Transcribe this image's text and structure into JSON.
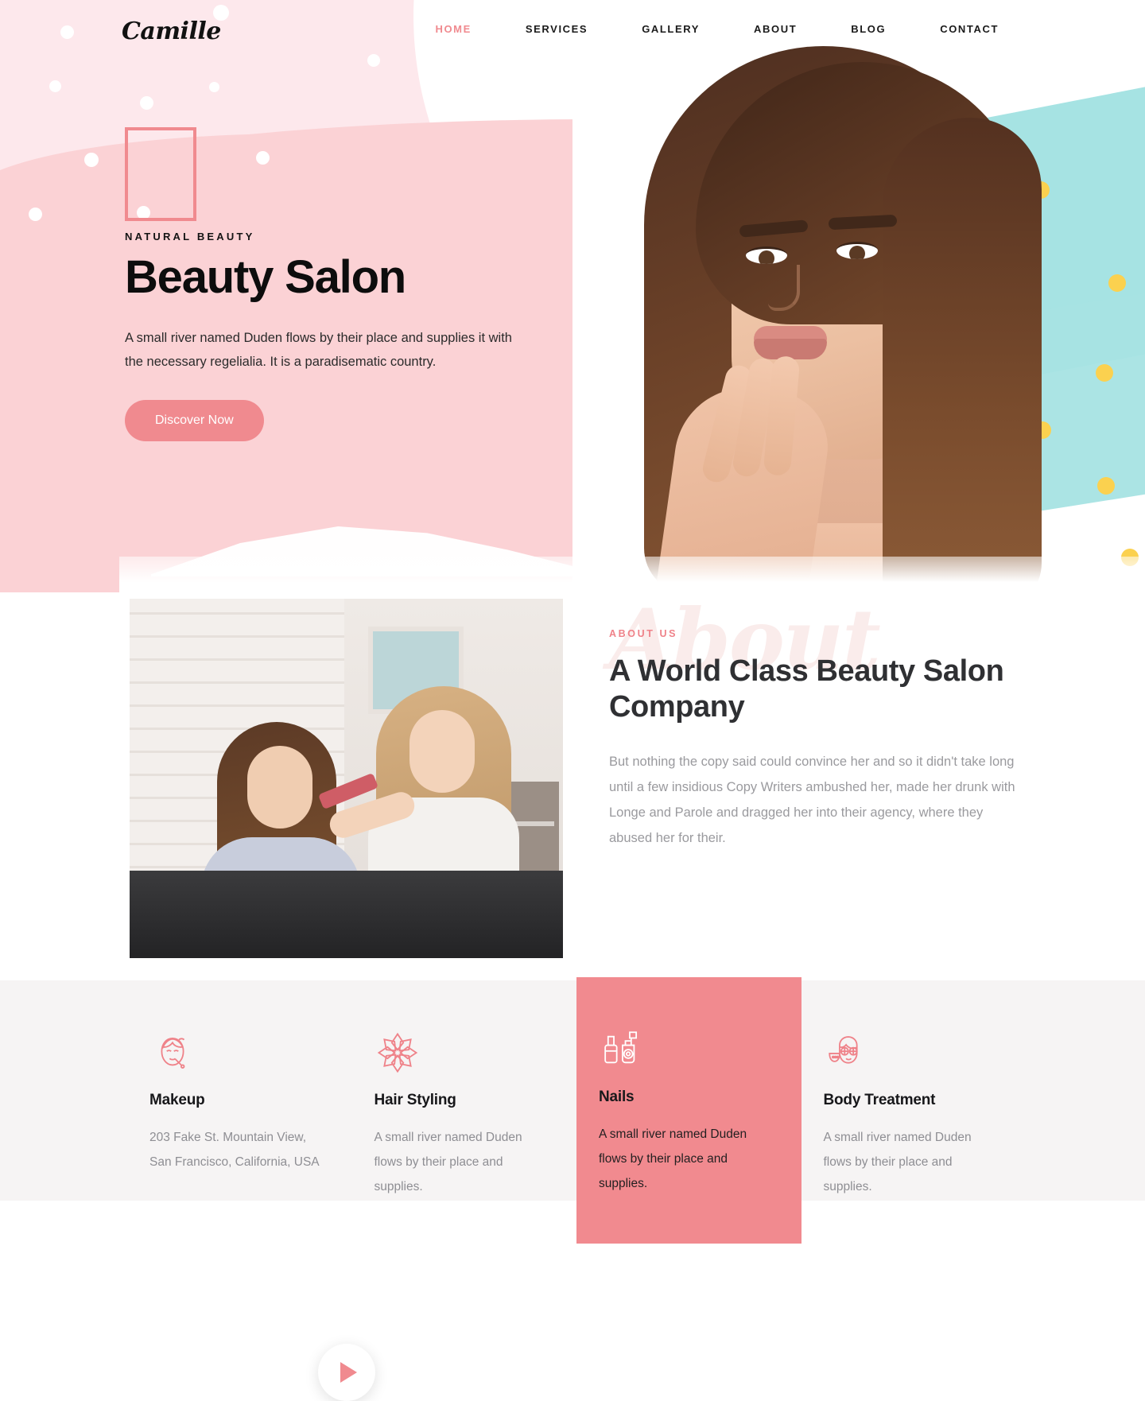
{
  "site": {
    "logo": "Camille",
    "accent_pink": "#F08A8F",
    "hero_bg_light": "#FDE8EC",
    "hero_bg_pink": "#FBD2D5",
    "mint": "#A6E3E3",
    "yellow": "#FBD14F",
    "services_bg": "#F6F4F4",
    "highlight_bg": "#F18A8F"
  },
  "nav": {
    "items": [
      {
        "label": "HOME",
        "active": true
      },
      {
        "label": "SERVICES",
        "active": false
      },
      {
        "label": "GALLERY",
        "active": false
      },
      {
        "label": "ABOUT",
        "active": false
      },
      {
        "label": "BLOG",
        "active": false
      },
      {
        "label": "CONTACT",
        "active": false
      }
    ]
  },
  "hero": {
    "eyebrow": "NATURAL BEAUTY",
    "title": "Beauty Salon",
    "text": "A small river named Duden flows by their place and supplies it with the necessary regelialia. It is a paradisematic country.",
    "button": "Discover Now"
  },
  "about": {
    "watermark": "About",
    "eyebrow": "ABOUT US",
    "title": "A World Class Beauty Salon Company",
    "text": "But nothing the copy said could convince her and so it didn't take long until a few insidious Copy Writers ambushed her, made her drunk with Longe and Parole and dragged her into their agency, where they abused her for their.",
    "play_icon": "play-icon"
  },
  "services": {
    "cards": [
      {
        "icon": "makeup-face-icon",
        "name": "Makeup",
        "desc": "203 Fake St. Mountain View, San Francisco, California, USA",
        "highlight": false
      },
      {
        "icon": "flower-mandala-icon",
        "name": "Hair Styling",
        "desc": "A small river named Duden flows by their place and supplies.",
        "highlight": false
      },
      {
        "icon": "nail-polish-icon",
        "name": "Nails",
        "desc": "A small river named Duden flows by their place and supplies.",
        "highlight": true
      },
      {
        "icon": "spa-mask-face-icon",
        "name": "Body Treatment",
        "desc": "A small river named Duden flows by their place and supplies.",
        "highlight": false
      }
    ]
  }
}
